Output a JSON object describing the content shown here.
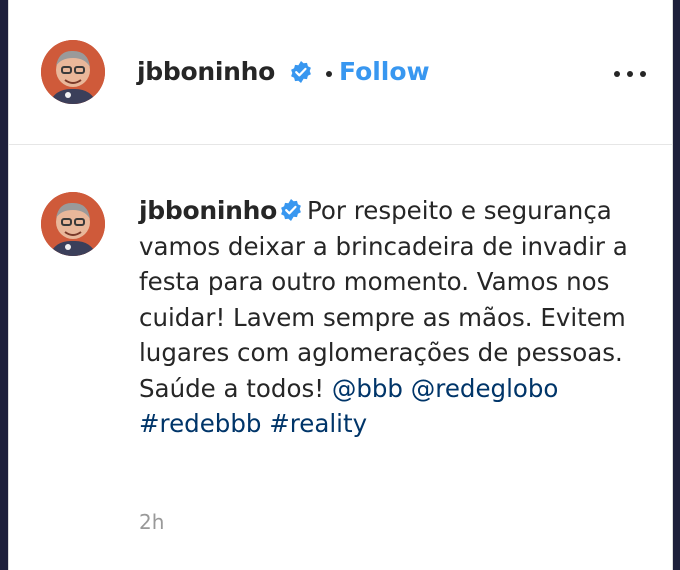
{
  "post": {
    "username": "jbboninho",
    "separator": "•",
    "follow_label": "Follow",
    "more_icon": "more-options-icon"
  },
  "comment": {
    "username": "jbboninho",
    "text": "Por respeito e segurança vamos deixar a brincadeira de invadir a festa para outro momento. Vamos nos cuidar! Lavem sempre as mãos. Evitem lugares com aglomerações de pessoas. Saúde a todos!",
    "tags": [
      "@bbb",
      "@redeglobo",
      "#redebbb",
      "#reality"
    ],
    "time": "2h"
  },
  "colors": {
    "link": "#3897f0",
    "tag": "#003569",
    "verified": "#3897f0",
    "text": "#262626",
    "muted": "#999999"
  }
}
